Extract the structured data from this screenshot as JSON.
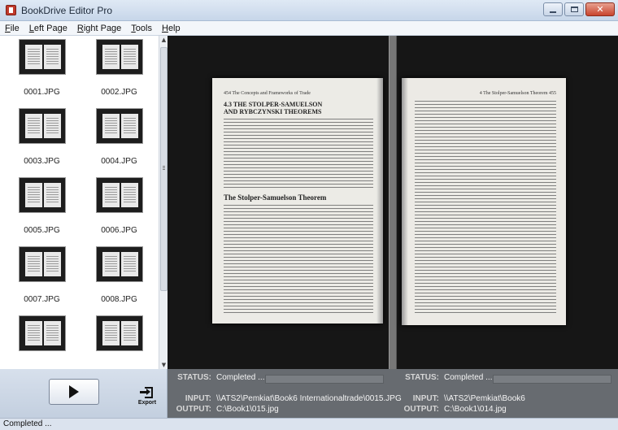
{
  "window": {
    "title": "BookDrive Editor Pro"
  },
  "menu": {
    "items": [
      {
        "accel": "F",
        "rest": "ile"
      },
      {
        "accel": "L",
        "rest": "eft Page"
      },
      {
        "accel": "R",
        "rest": "ight Page"
      },
      {
        "accel": "T",
        "rest": "ools"
      },
      {
        "accel": "H",
        "rest": "elp"
      }
    ]
  },
  "thumbnails": [
    {
      "label": "0001.JPG"
    },
    {
      "label": "0002.JPG"
    },
    {
      "label": "0003.JPG"
    },
    {
      "label": "0004.JPG"
    },
    {
      "label": "0005.JPG"
    },
    {
      "label": "0006.JPG"
    },
    {
      "label": "0007.JPG"
    },
    {
      "label": "0008.JPG"
    },
    {
      "label": ""
    },
    {
      "label": ""
    }
  ],
  "viewer": {
    "left_page": {
      "running_head": "454  The Concepts and Frameworks of Trade",
      "heading1": "4.3  THE STOLPER-SAMUELSON",
      "heading2": "AND RYBCZYNSKI THEOREMS",
      "subheading": "The Stolper-Samuelson Theorem"
    },
    "right_page": {
      "running_head": "4  The Stolper-Samuelson Theorem  455"
    }
  },
  "status": {
    "left": {
      "status_key": "STATUS:",
      "status_val": "Completed ...",
      "input_key": "INPUT:",
      "input_val": "\\\\ATS2\\Pemkiat\\Book6 Internationaltrade\\0015.JPG",
      "output_key": "OUTPUT:",
      "output_val": "C:\\Book1\\015.jpg"
    },
    "right": {
      "status_key": "STATUS:",
      "status_val": "Completed ...",
      "input_key": "INPUT:",
      "input_val": "\\\\ATS2\\Pemkiat\\Book6",
      "output_key": "OUTPUT:",
      "output_val": "C:\\Book1\\014.jpg"
    }
  },
  "controls": {
    "export_label": "Export",
    "play_icon": "play-icon",
    "export_icon": "export-icon"
  },
  "statusbar": {
    "text": "Completed ..."
  }
}
